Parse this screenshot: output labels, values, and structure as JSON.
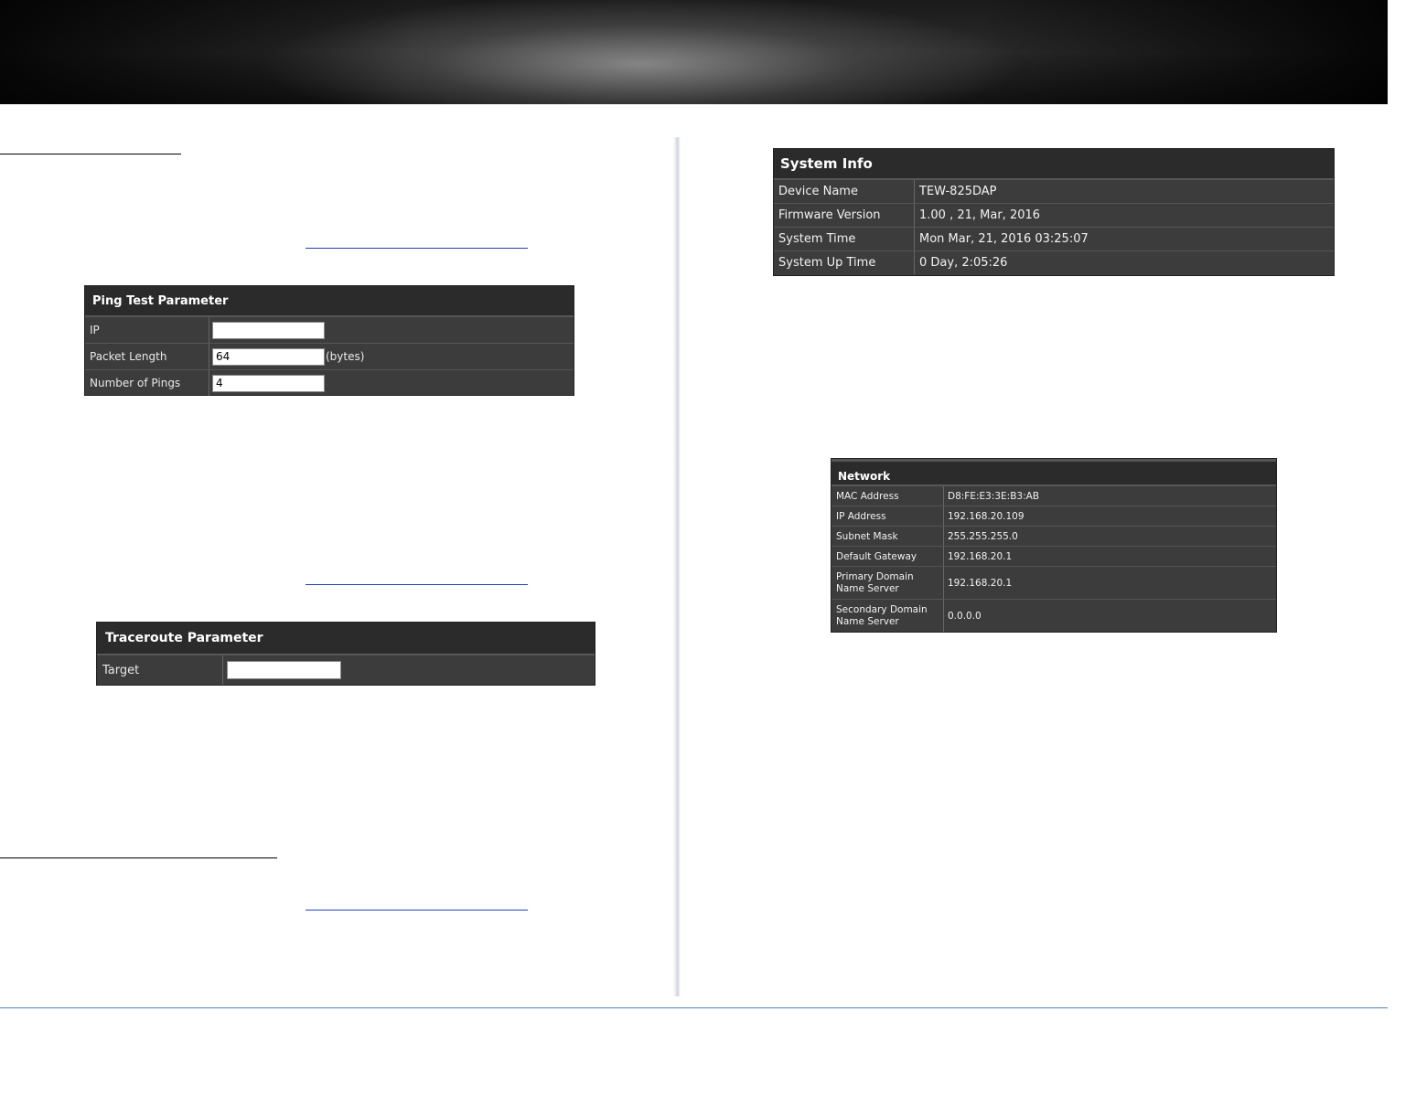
{
  "ping": {
    "title": "Ping Test Parameter",
    "rows": [
      {
        "label": "IP",
        "value": "",
        "suffix": ""
      },
      {
        "label": "Packet Length",
        "value": "64",
        "suffix": "(bytes)"
      },
      {
        "label": "Number of Pings",
        "value": "4",
        "suffix": ""
      }
    ]
  },
  "traceroute": {
    "title": "Traceroute Parameter",
    "rows": [
      {
        "label": "Target",
        "value": ""
      }
    ]
  },
  "system_info": {
    "title": "System Info",
    "rows": [
      {
        "label": "Device Name",
        "value": "TEW-825DAP"
      },
      {
        "label": "Firmware Version",
        "value": "1.00 , 21, Mar, 2016"
      },
      {
        "label": "System Time",
        "value": "Mon Mar, 21, 2016 03:25:07"
      },
      {
        "label": "System Up Time",
        "value": "0 Day, 2:05:26"
      }
    ]
  },
  "network": {
    "title": "Network",
    "rows": [
      {
        "label": "MAC Address",
        "value": "D8:FE:E3:3E:B3:AB"
      },
      {
        "label": "IP Address",
        "value": "192.168.20.109"
      },
      {
        "label": "Subnet Mask",
        "value": "255.255.255.0"
      },
      {
        "label": "Default Gateway",
        "value": "192.168.20.1"
      },
      {
        "label": "Primary Domain Name Server",
        "value": "192.168.20.1"
      },
      {
        "label": "Secondary Domain Name Server",
        "value": "0.0.0.0"
      }
    ]
  }
}
